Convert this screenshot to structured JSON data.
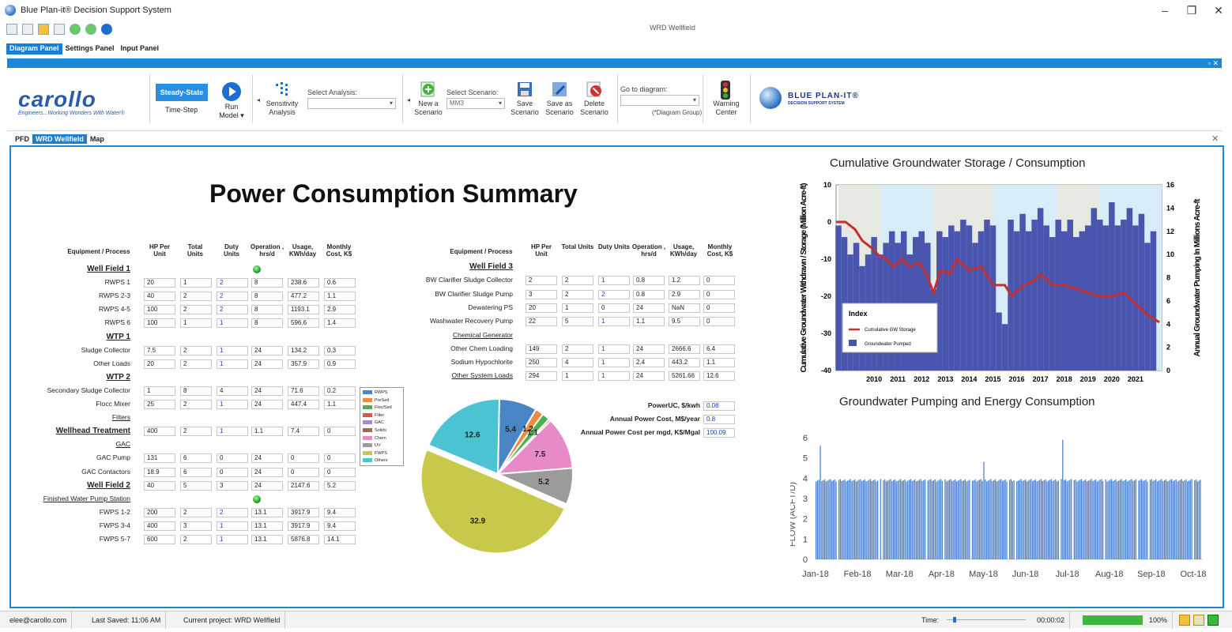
{
  "window": {
    "title": "Blue Plan-it® Decision Support System",
    "doc_title": "WRD Wellfield",
    "controls": [
      "–",
      "❐",
      "✕"
    ]
  },
  "menu": {
    "tabs": [
      "Diagram Panel",
      "Settings Panel",
      "Input Panel"
    ]
  },
  "ribbon": {
    "collapse_controls": "▫ ✕",
    "logo_text": "carollo",
    "logo_tagline": "Engineers...Working Wonders With Water®",
    "steady_state": "Steady-State",
    "time_step": "Time-Step",
    "run_model": "Run Model ▾",
    "sensitivity": "Sensitivity Analysis",
    "select_analysis_label": "Select Analysis:",
    "select_analysis_value": "",
    "new_scenario": "New a Scenario",
    "select_scenario_label": "Select Scenario:",
    "select_scenario_value": "MM3",
    "save_scenario": "Save Scenario",
    "save_as_scenario": "Save as Scenario",
    "delete_scenario": "Delete Scenario",
    "goto_label": "Go to diagram:",
    "goto_hint": "(*Diagram Group)",
    "warning_center": "Warning Center",
    "brand_title": "BLUE PLAN-IT®",
    "brand_sub": "DECISION SUPPORT SYSTEM"
  },
  "doc_tabs": [
    "PFD",
    "WRD Wellfield",
    "Map"
  ],
  "summary": {
    "title": "Power Consumption Summary",
    "headers": [
      "Equipment / Process",
      "HP Per Unit",
      "Total Units",
      "Duty Units",
      "Operation , hrs/d",
      "Usage, KWh/day",
      "Monthly Cost, K$"
    ],
    "left_rows": [
      {
        "label": "Well Field 1",
        "type": "section",
        "ok": true
      },
      {
        "label": "RWPS 1",
        "vals": [
          "20",
          "1",
          "2",
          "8",
          "238.6",
          "0.6"
        ]
      },
      {
        "label": "RWPS 2-3",
        "vals": [
          "40",
          "2",
          "2",
          "8",
          "477.2",
          "1.1"
        ]
      },
      {
        "label": "RWPS 4-5",
        "vals": [
          "100",
          "2",
          "2",
          "8",
          "1193.1",
          "2.9"
        ]
      },
      {
        "label": "RWPS 6",
        "vals": [
          "100",
          "1",
          "1",
          "8",
          "596.6",
          "1.4"
        ]
      },
      {
        "label": "WTP 1",
        "type": "section"
      },
      {
        "label": "Sludge Collector",
        "vals": [
          "7.5",
          "2",
          "1",
          "24",
          "134.2",
          "0.3"
        ]
      },
      {
        "label": "Other Loads",
        "vals": [
          "20",
          "2",
          "1",
          "24",
          "357.9",
          "0.9"
        ]
      },
      {
        "label": "WTP 2",
        "type": "section"
      },
      {
        "label": "Secondary Sludge Collector",
        "vals": [
          "1",
          "8",
          "4",
          "24",
          "71.6",
          "0.2"
        ]
      },
      {
        "label": "Flocc Mixer",
        "vals": [
          "25",
          "2",
          "1",
          "24",
          "447.4",
          "1.1"
        ]
      },
      {
        "label": "Filters",
        "type": "link"
      },
      {
        "label": "Wellhead Treatment",
        "type": "section",
        "vals": [
          "400",
          "2",
          "1",
          "1.1",
          "7.4",
          "0"
        ]
      },
      {
        "label": "GAC",
        "type": "link"
      },
      {
        "label": "GAC Pump",
        "vals": [
          "131",
          "6",
          "0",
          "24",
          "0",
          "0"
        ]
      },
      {
        "label": "GAC Contactors",
        "vals": [
          "18.9",
          "6",
          "0",
          "24",
          "0",
          "0"
        ]
      },
      {
        "label": "Well Field 2",
        "type": "section",
        "vals": [
          "40",
          "5",
          "3",
          "24",
          "2147.6",
          "5.2"
        ]
      },
      {
        "label": "Finished Water Pump Station",
        "type": "link",
        "ok": true
      },
      {
        "label": "FWPS 1-2",
        "vals": [
          "200",
          "2",
          "2",
          "13.1",
          "3917.9",
          "9.4"
        ]
      },
      {
        "label": "FWPS 3-4",
        "vals": [
          "400",
          "3",
          "1",
          "13.1",
          "3917.9",
          "9.4"
        ]
      },
      {
        "label": "FWPS 5-7",
        "vals": [
          "600",
          "2",
          "1",
          "13.1",
          "5876.8",
          "14.1"
        ]
      }
    ],
    "right_rows": [
      {
        "label": "Well Field 3",
        "type": "section"
      },
      {
        "label": "BW Clarifier Sludge Collector",
        "vals": [
          "2",
          "2",
          "1",
          "0.8",
          "1.2",
          "0"
        ]
      },
      {
        "label": "BW Clarifier Sludge Pump",
        "vals": [
          "3",
          "2",
          "2",
          "0.8",
          "2.9",
          "0"
        ]
      },
      {
        "label": "Dewatering PS",
        "vals": [
          "20",
          "1",
          "0",
          "24",
          "NaN",
          "0"
        ]
      },
      {
        "label": "Washwater Recovery Pump",
        "vals": [
          "22",
          "5",
          "1",
          "1.1",
          "9.5",
          "0"
        ]
      },
      {
        "label": "Chemical Generator",
        "type": "link"
      },
      {
        "label": "Other Chem Loading",
        "vals": [
          "149",
          "2",
          "1",
          "24",
          "2666.6",
          "6.4"
        ]
      },
      {
        "label": "Sodium Hypochlorite",
        "vals": [
          "250",
          "4",
          "1",
          "2.4",
          "443.2",
          "1.1"
        ]
      },
      {
        "label": "Other System Loads",
        "type": "link",
        "vals": [
          "294",
          "1",
          "1",
          "24",
          "5261.66",
          "12.6"
        ]
      }
    ],
    "cost": [
      {
        "label": "PowerUC, $/kwh",
        "value": "0.08"
      },
      {
        "label": "Annual Power Cost, M$/year",
        "value": "0.8"
      },
      {
        "label": "Annual Power Cost per mgd, K$/Mgal",
        "value": "100.09"
      }
    ]
  },
  "chart_data": [
    {
      "type": "pie",
      "legend": [
        "RWPS",
        "PreSed",
        "Floc/Sed",
        "Filter",
        "GAC",
        "Solids",
        "Chem",
        "UV",
        "FWPS",
        "Others"
      ],
      "colors": [
        "#4a86c5",
        "#f08a3c",
        "#4caf50",
        "#e05252",
        "#a98bc9",
        "#9b6a5c",
        "#e88ac8",
        "#9b9b9b",
        "#c8c84a",
        "#4cc3d3"
      ],
      "slices": [
        {
          "name": "RWPS",
          "value": 5.4
        },
        {
          "name": "PreSed",
          "value": 1.2
        },
        {
          "name": "Floc/Sed",
          "value": 1.1
        },
        {
          "name": "Filter",
          "value": 0.3
        },
        {
          "name": "Chem",
          "value": 7.5
        },
        {
          "name": "UV",
          "value": 5.2
        },
        {
          "name": "FWPS",
          "value": 32.9
        },
        {
          "name": "Others",
          "value": 12.6
        }
      ],
      "labels": [
        "5.4",
        "1.2",
        "1.1",
        "7.5",
        "5.2",
        "32.9",
        "12.6"
      ]
    },
    {
      "type": "bar+line",
      "title": "Cumulative Groundwater Storage / Consumption",
      "ylabel_left": "Cumulative Groundwater Withdrawn / Storage (Million Acre-ft)",
      "ylabel_right": "Annual Groundwater Pumping In Millions Acre-ft",
      "ylim_left": [
        -40,
        10
      ],
      "ylim_right": [
        0,
        16
      ],
      "yticks_left": [
        "10",
        "0",
        "-10",
        "-20",
        "-30",
        "-40"
      ],
      "yticks_right": [
        "16",
        "14",
        "12",
        "10",
        "8",
        "6",
        "4",
        "2",
        "0"
      ],
      "xticks": [
        "2010",
        "2011",
        "2012",
        "2013",
        "2014",
        "2015",
        "2016",
        "2017",
        "2018",
        "2019",
        "2020",
        "2021"
      ],
      "xlim": [
        2008.9,
        2022.6
      ],
      "legend_title": "Index",
      "series": [
        {
          "name": "Cumulative GW Storage",
          "color": "#c43030",
          "x": [
            2008.9,
            2009.3,
            2009.7,
            2010.0,
            2010.4,
            2010.7,
            2011.0,
            2011.3,
            2011.7,
            2012.0,
            2012.4,
            2012.7,
            2013.0,
            2013.3,
            2013.7,
            2014.0,
            2014.5,
            2015.0,
            2015.5,
            2016.0,
            2016.3,
            2016.8,
            2017.2,
            2017.5,
            2018.0,
            2018.5,
            2019.0,
            2019.5,
            2020.0,
            2020.5,
            2021.0,
            2021.5,
            2022.0,
            2022.5
          ],
          "y": [
            0,
            0,
            -2,
            -5,
            -7,
            -9,
            -10,
            -12,
            -10,
            -12,
            -11,
            -14,
            -19,
            -13,
            -14,
            -10,
            -13,
            -12,
            -17,
            -17,
            -20,
            -17,
            -16,
            -14,
            -17,
            -17,
            -18,
            -19,
            -20,
            -20,
            -19,
            -22,
            -25,
            -27
          ]
        },
        {
          "name": "Groundwater Pumped",
          "color": "#4a55b0",
          "units": "Millions Acre-ft",
          "x": [
            2009.0,
            2009.25,
            2009.5,
            2009.75,
            2010.0,
            2010.25,
            2010.5,
            2010.75,
            2011.0,
            2011.25,
            2011.5,
            2011.75,
            2012.0,
            2012.25,
            2012.5,
            2012.75,
            2013.0,
            2013.25,
            2013.5,
            2013.75,
            2014.0,
            2014.25,
            2014.5,
            2014.75,
            2015.0,
            2015.25,
            2015.5,
            2015.75,
            2016.0,
            2016.25,
            2016.5,
            2016.75,
            2017.0,
            2017.25,
            2017.5,
            2017.75,
            2018.0,
            2018.25,
            2018.5,
            2018.75,
            2019.0,
            2019.25,
            2019.5,
            2019.75,
            2020.0,
            2020.25,
            2020.5,
            2020.75,
            2021.0,
            2021.25,
            2021.5,
            2021.75,
            2022.0,
            2022.25
          ],
          "y": [
            12.5,
            11.5,
            10.0,
            11.0,
            9.0,
            10.0,
            11.5,
            10.0,
            11.0,
            12.0,
            11.0,
            12.0,
            10.0,
            11.5,
            12.0,
            11.0,
            7.0,
            12.0,
            11.5,
            12.5,
            12.0,
            13.0,
            12.5,
            11.0,
            12.0,
            13.0,
            12.5,
            5.0,
            4.0,
            13.0,
            12.0,
            13.5,
            12.0,
            13.0,
            14.0,
            12.5,
            11.5,
            13.0,
            12.0,
            13.0,
            11.5,
            12.0,
            12.5,
            14.0,
            13.0,
            12.5,
            14.5,
            12.5,
            13.0,
            14.0,
            12.5,
            13.5,
            11.0,
            12.0
          ]
        }
      ]
    },
    {
      "type": "bar",
      "title": "Groundwater Pumping and Energy Consumption",
      "ylabel": "FLOW (ACFT/D)",
      "ylim": [
        0,
        6
      ],
      "yticks": [
        "0",
        "1",
        "2",
        "3",
        "4",
        "5",
        "6"
      ],
      "xticks": [
        "Jan-18",
        "Feb-18",
        "Mar-18",
        "Apr-18",
        "May-18",
        "Jun-18",
        "Jul-18",
        "Aug-18",
        "Sep-18",
        "Oct-18"
      ],
      "color": "#4a7fcf",
      "baseline": 3.9,
      "spikes": [
        {
          "x": "Jan-18",
          "value": 5.6
        },
        {
          "x": "May-18",
          "value": 4.8
        },
        {
          "x": "Jul-18",
          "value": 5.9
        }
      ]
    }
  ],
  "status": {
    "user": "elee@carollo.com",
    "last_saved": "Last Saved: 11:06 AM",
    "project": "Current project: WRD Wellfield",
    "time_label": "Time:",
    "time_value": "00:00:02",
    "progress_pct": "100%",
    "progress_value": 1.0
  }
}
